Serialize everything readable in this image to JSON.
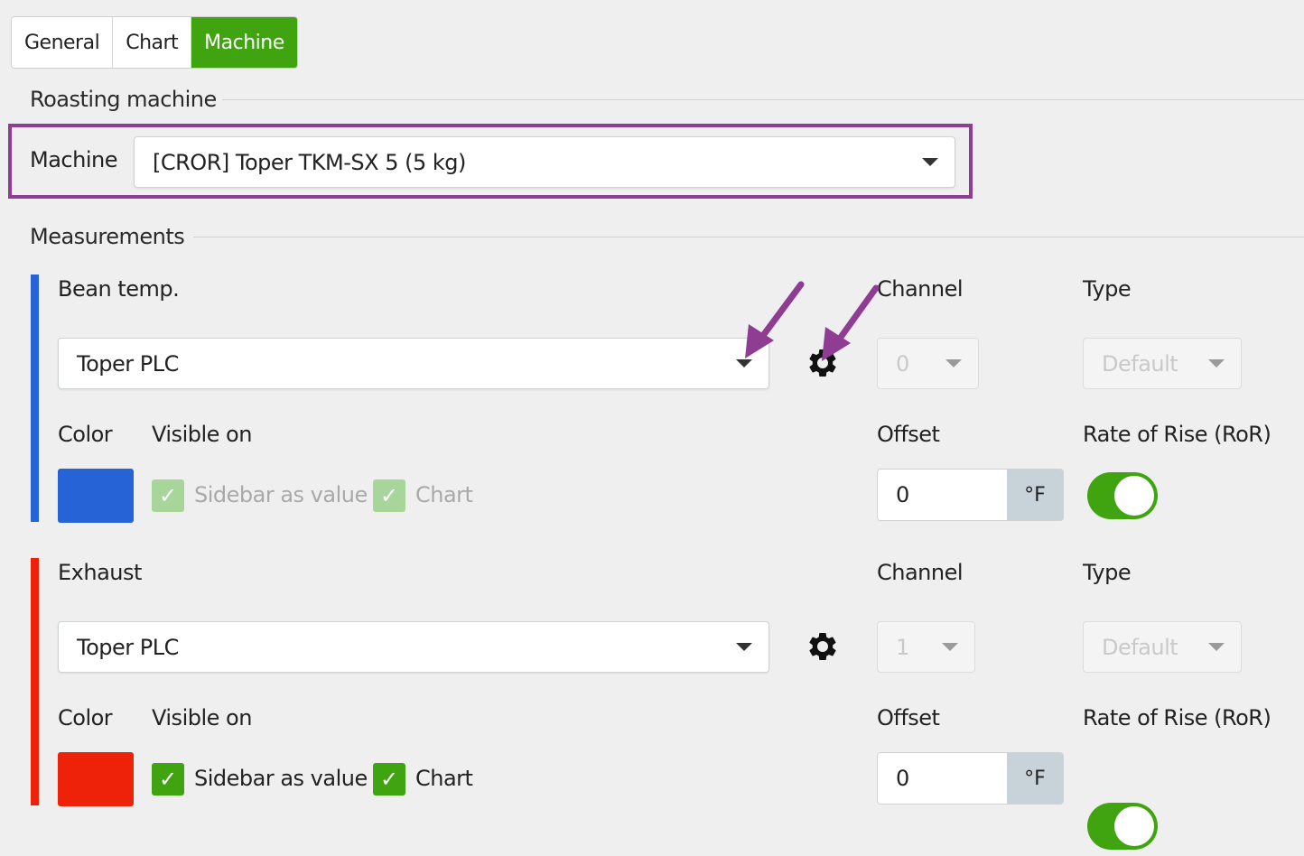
{
  "tabs": [
    {
      "label": "General",
      "active": false
    },
    {
      "label": "Chart",
      "active": false
    },
    {
      "label": "Machine",
      "active": true
    }
  ],
  "roasting_machine": {
    "title": "Roasting machine",
    "machine_label": "Machine",
    "machine_value": "[CROR] Toper TKM-SX 5 (5 kg)"
  },
  "measurements": {
    "title": "Measurements",
    "items": [
      {
        "name": "Bean temp.",
        "accent": "#2563d6",
        "source": "Toper PLC",
        "channel_label": "Channel",
        "channel_value": "0",
        "type_label": "Type",
        "type_value": "Default",
        "color_label": "Color",
        "color": "#2563d6",
        "visible_on_label": "Visible on",
        "sidebar_label": "Sidebar as value",
        "chart_label": "Chart",
        "sidebar_checked": true,
        "chart_checked": true,
        "options_enabled": false,
        "offset_label": "Offset",
        "offset_value": "0",
        "offset_unit": "°F",
        "ror_label": "Rate of Rise (RoR)",
        "ror_on": true
      },
      {
        "name": "Exhaust",
        "accent": "#ee2208",
        "source": "Toper PLC",
        "channel_label": "Channel",
        "channel_value": "1",
        "type_label": "Type",
        "type_value": "Default",
        "color_label": "Color",
        "color": "#ee2208",
        "visible_on_label": "Visible on",
        "sidebar_label": "Sidebar as value",
        "chart_label": "Chart",
        "sidebar_checked": true,
        "chart_checked": true,
        "options_enabled": true,
        "offset_label": "Offset",
        "offset_value": "0",
        "offset_unit": "°F",
        "ror_label": "Rate of Rise (RoR)",
        "ror_on": true
      }
    ]
  },
  "colors": {
    "accent_green": "#3fa40f",
    "annotation_purple": "#8e3d92"
  },
  "icons": [
    "gear-icon",
    "chevron-down-icon",
    "check-icon",
    "annotation-arrow-icon"
  ]
}
